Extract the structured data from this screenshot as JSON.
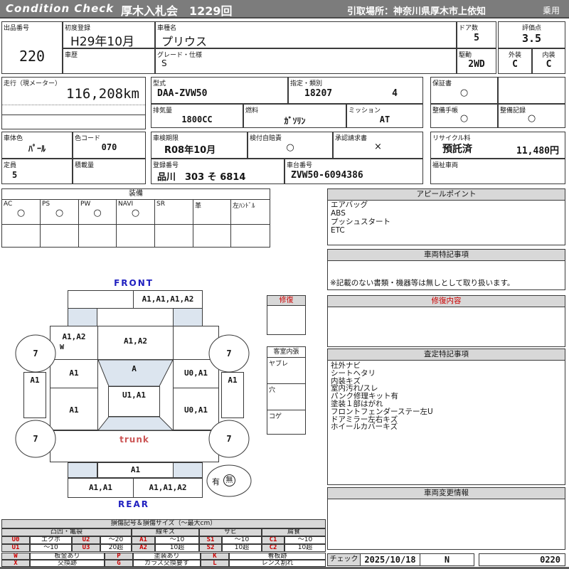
{
  "colors": {
    "top_bar": "#7c7c7c",
    "panel_header": "#d8d8d8",
    "accent_red": "#cc0000",
    "accent_blue": "#2020c0",
    "diagram_shade": "#dce5ef"
  },
  "header": {
    "brand": "Condition Check",
    "auction": "厚木入札会　1229回",
    "pickup": "引取場所：神奈川県厚木市上依知",
    "category": "乗用"
  },
  "info": {
    "lot_label": "出品番号",
    "lot_value": "220",
    "first_reg_label": "初度登録",
    "first_reg_value": "H29年10月",
    "history_label": "車歴",
    "model_label": "車種名",
    "model_value": "プリウス",
    "grade_label": "グレード・仕様",
    "grade_value": "S",
    "doors_label": "ドア数",
    "doors_value": "5",
    "drive_label": "駆動",
    "drive_value": "2WD",
    "score_label": "評価点",
    "score_value": "3.5",
    "exterior_label": "外装",
    "exterior_value": "C",
    "interior_label": "内装",
    "interior_value": "C"
  },
  "spec": {
    "mileage_label": "走行（現メーター）",
    "mileage_value": "116,208km",
    "model_code_label": "型式",
    "model_code_value": "DAA-ZVW50",
    "class_label": "指定・類別",
    "class_value_a": "18207",
    "class_value_b": "4",
    "displacement_label": "排気量",
    "displacement_value": "1800CC",
    "fuel_label": "燃料",
    "fuel_value": "ｶﾞｿﾘﾝ",
    "mission_label": "ミッション",
    "mission_value": "AT",
    "warranty_label": "保証書",
    "warranty_value": "○",
    "maintenance_book_label": "整備手帳",
    "maintenance_book_value": "○",
    "maintenance_record_label": "整備記録",
    "maintenance_record_value": "○"
  },
  "reg": {
    "color_label": "車体色",
    "color_value": "ﾊﾟｰﾙ",
    "color_code_label": "色コード",
    "color_code_value": "070",
    "capacity_label": "定員",
    "capacity_value": "5",
    "load_label": "積載量",
    "inspection_label": "車検期限",
    "inspection_value": "R08年10月",
    "insurance_label": "検付自賠責",
    "insurance_value": "○",
    "approval_label": "承認請求書",
    "approval_value": "×",
    "reg_no_label": "登録番号",
    "reg_no_value": "品川　303 そ 6814",
    "chassis_label": "車台番号",
    "chassis_value": "ZVW50-6094386",
    "recycle_label": "リサイクル料",
    "recycle_status": "預託済",
    "recycle_fee": "11,480円",
    "welfare_label": "福祉車両"
  },
  "equipment": {
    "title": "装備",
    "items": [
      {
        "label": "AC",
        "value": "○"
      },
      {
        "label": "PS",
        "value": "○"
      },
      {
        "label": "PW",
        "value": "○"
      },
      {
        "label": "NAVI",
        "value": "○"
      },
      {
        "label": "SR",
        "value": ""
      },
      {
        "label": "革",
        "value": ""
      },
      {
        "label": "左ﾊﾝﾄﾞﾙ",
        "value": ""
      }
    ]
  },
  "panels": {
    "appeal": {
      "title": "アピールポイント",
      "lines": [
        "エアバッグ",
        "ABS",
        "プッシュスタート",
        "ETC"
      ]
    },
    "special": {
      "title": "車両特記事項",
      "note": "※記載のない書類・機器等は無しとして取り扱います。"
    },
    "repair_detail": {
      "title": "修復内容"
    },
    "assessment": {
      "title": "査定特記事項",
      "lines": [
        "社外ナビ",
        "シートヘタリ",
        "内装キズ",
        "室内汚れ/スレ",
        "パンク修理キット有",
        "塗装１部はがれ",
        "フロントフェンダーステー左U",
        "ドアミラー左右キズ",
        "ホイールカバーキズ"
      ]
    },
    "change_info": {
      "title": "車両変更情報"
    }
  },
  "repair_box": {
    "title": "修復"
  },
  "cabin_box": {
    "title": "客室内張",
    "row1": "ヤブレ",
    "row2": "穴",
    "row3": "コゲ"
  },
  "diagram": {
    "front_label": "FRONT",
    "rear_label": "REAR",
    "trunk_label": "trunk",
    "front_bumper_right": "A1,A1,A1,A2",
    "left_fender": "A1,A2",
    "left_fender_mark": "W",
    "hood": "A1,A2",
    "left_front_door": "A1",
    "windshield": "A",
    "right_front_door": "U0,A1",
    "roof": "U1,A1",
    "left_rear_door": "A1",
    "right_rear_door": "U0,A1",
    "left_sill": "A1",
    "right_sill": "A1",
    "rear_panel": "A1",
    "rear_bumper_left": "A1,A1",
    "rear_bumper_right": "A1,A1,A2",
    "wheel_mark": "7",
    "repair_history_yes": "有",
    "repair_history_no": "無"
  },
  "legend": {
    "title": "損傷記号＆損傷サイズ（～最大cm）",
    "group1": "凸凹・亀裂",
    "group2": "線キズ",
    "group3": "サビ",
    "group4": "腐食",
    "r1": [
      "U0",
      "エクボ",
      "U2",
      "～20",
      "A1",
      "～10",
      "S1",
      "～10",
      "C1",
      "～10"
    ],
    "r2": [
      "U1",
      "～10",
      "U3",
      "20超",
      "A2",
      "10超",
      "S2",
      "10超",
      "C2",
      "10超"
    ],
    "r3": [
      "W",
      "板金あり",
      "P",
      "塗装あり",
      "K",
      "看板跡"
    ],
    "r4": [
      "X",
      "交換跡",
      "G",
      "ガラス交換要す",
      "L",
      "レンズ割れ"
    ]
  },
  "check": {
    "label": "チェック",
    "date": "2025/10/18",
    "flag": "N",
    "lot": "0220"
  }
}
